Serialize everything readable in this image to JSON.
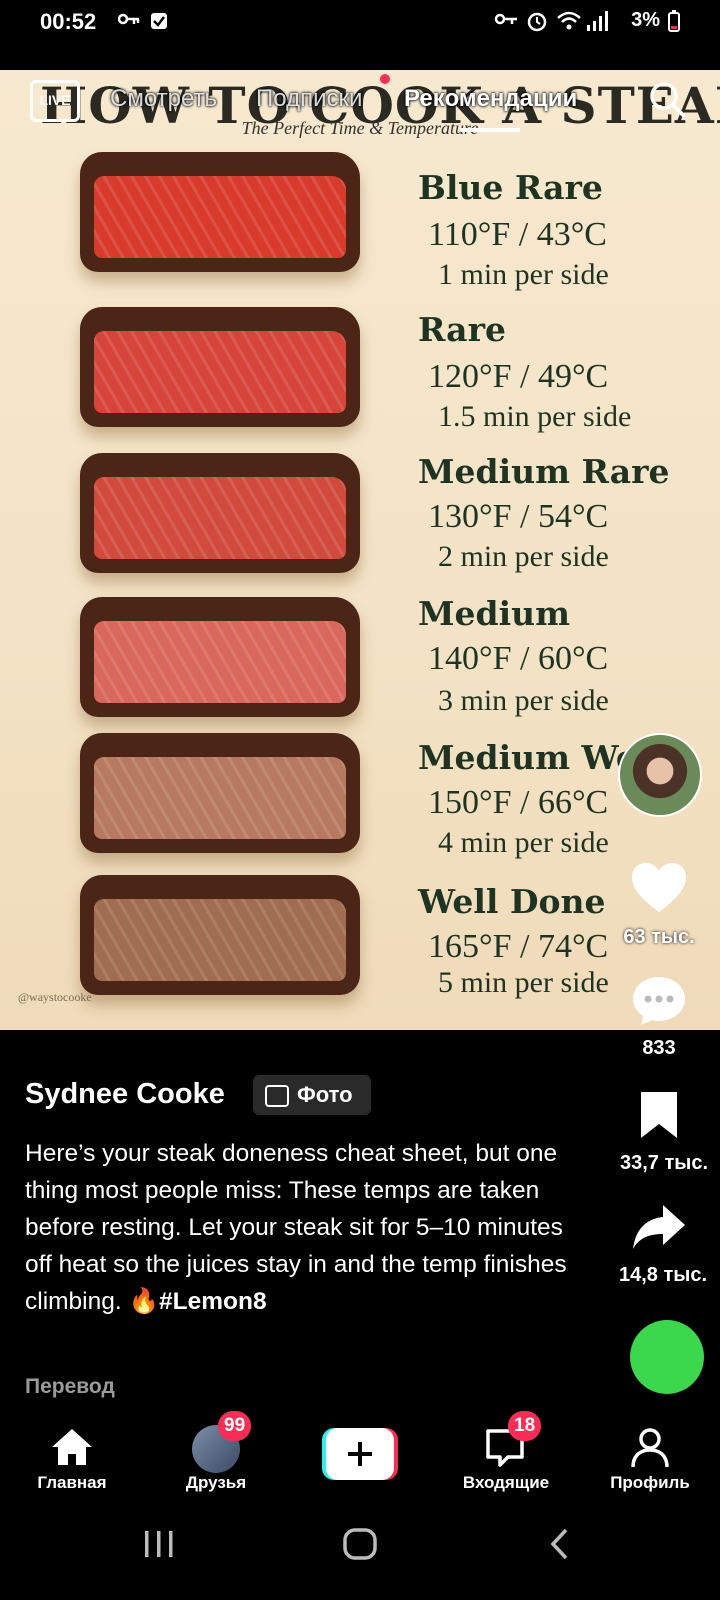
{
  "status_bar": {
    "time": "00:52",
    "battery": "3%"
  },
  "poster": {
    "title": "HOW TO COOK A STEAK",
    "subtitle": "The Perfect Time & Temperature",
    "watermark": "@waystocooke",
    "items": [
      {
        "name": "Blue Rare",
        "temp": "110°F / 43°C",
        "time": "1 min per side",
        "color": "#d83a2c"
      },
      {
        "name": "Rare",
        "temp": "120°F / 49°C",
        "time": "1.5 min per side",
        "color": "#d6443a"
      },
      {
        "name": "Medium Rare",
        "temp": "130°F / 54°C",
        "time": "2 min per side",
        "color": "#d24a3c"
      },
      {
        "name": "Medium",
        "temp": "140°F / 60°C",
        "time": "3 min per side",
        "color": "#d9675c"
      },
      {
        "name": "Medium Well",
        "temp": "150°F / 66°C",
        "time": "4 min per side",
        "color": "#b77a60"
      },
      {
        "name": "Well Done",
        "temp": "165°F / 74°C",
        "time": "5 min per side",
        "color": "#a16d50"
      }
    ]
  },
  "top_tabs": {
    "tabs": [
      "Смотреть",
      "Подписки",
      "Рекомендации"
    ],
    "active": "Рекомендации"
  },
  "rail": {
    "likes": "63 тыс.",
    "comments": "833",
    "saves": "33,7 тыс.",
    "shares": "14,8 тыс."
  },
  "post": {
    "author": "Sydnee Cooke",
    "badge_label": "Фото",
    "caption": "Here’s your steak doneness cheat sheet, but one thing most people miss: These temps are taken before resting. Let your steak sit for 5–10 minutes off heat so the juices stay in and the temp finishes climbing.",
    "hashtag": "#Lemon8",
    "translate_label": "Перевод"
  },
  "nav": {
    "home": "Главная",
    "friends": "Друзья",
    "friends_badge": "99",
    "inbox": "Входящие",
    "inbox_badge": "18",
    "profile": "Профиль"
  },
  "colors": {
    "accent": "#fe2c55",
    "cyan": "#25f4ee",
    "poster_bg": "#f5e6cb",
    "poster_text": "#1f3322"
  }
}
